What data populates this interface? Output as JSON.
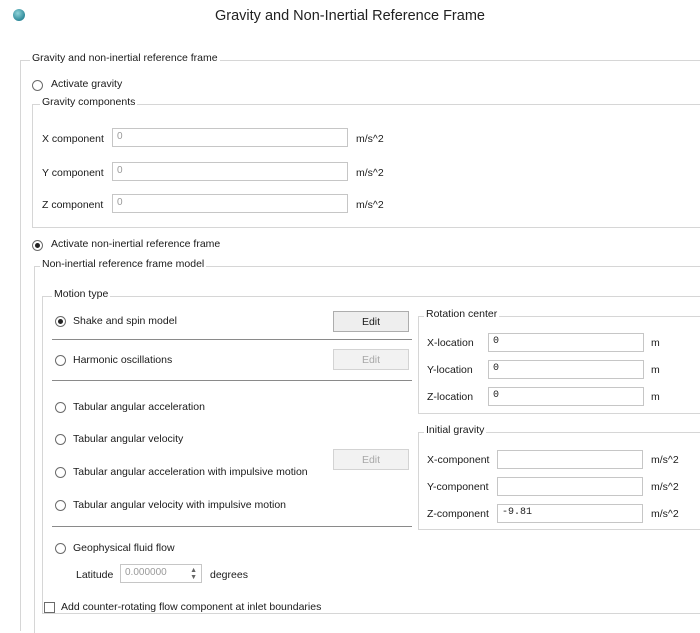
{
  "window": {
    "title": "Gravity and Non-Inertial Reference Frame"
  },
  "outer_group": {
    "label": "Gravity and non-inertial reference frame"
  },
  "gravity": {
    "activate_label": "Activate gravity",
    "components_label": "Gravity components",
    "x": {
      "label": "X component",
      "value": "0",
      "unit": "m/s^2"
    },
    "y": {
      "label": "Y component",
      "value": "0",
      "unit": "m/s^2"
    },
    "z": {
      "label": "Z component",
      "value": "0",
      "unit": "m/s^2"
    }
  },
  "non_inertial": {
    "activate_label": "Activate non-inertial reference frame",
    "model_label": "Non-inertial reference frame model",
    "motion_type_label": "Motion type",
    "options": {
      "shake_spin": "Shake and spin model",
      "harmonic": "Harmonic oscillations",
      "tab_ang_acc": "Tabular angular acceleration",
      "tab_ang_vel": "Tabular angular velocity",
      "tab_ang_acc_imp": "Tabular angular acceleration with impulsive motion",
      "tab_ang_vel_imp": "Tabular angular velocity with impulsive motion",
      "geo_fluid": "Geophysical fluid flow"
    },
    "edit_label": "Edit",
    "latitude": {
      "label": "Latitude",
      "value": "0.000000",
      "unit": "degrees"
    },
    "rotation_center": {
      "label": "Rotation center",
      "x": {
        "label": "X-location",
        "value": "0",
        "unit": "m"
      },
      "y": {
        "label": "Y-location",
        "value": "0",
        "unit": "m"
      },
      "z": {
        "label": "Z-location",
        "value": "0",
        "unit": "m"
      }
    },
    "initial_gravity": {
      "label": "Initial gravity",
      "x": {
        "label": "X-component",
        "value": "",
        "unit": "m/s^2"
      },
      "y": {
        "label": "Y-component",
        "value": "",
        "unit": "m/s^2"
      },
      "z": {
        "label": "Z-component",
        "value": "-9.81",
        "unit": "m/s^2"
      }
    },
    "counter_rotating_label": "Add counter-rotating flow component at inlet boundaries"
  }
}
